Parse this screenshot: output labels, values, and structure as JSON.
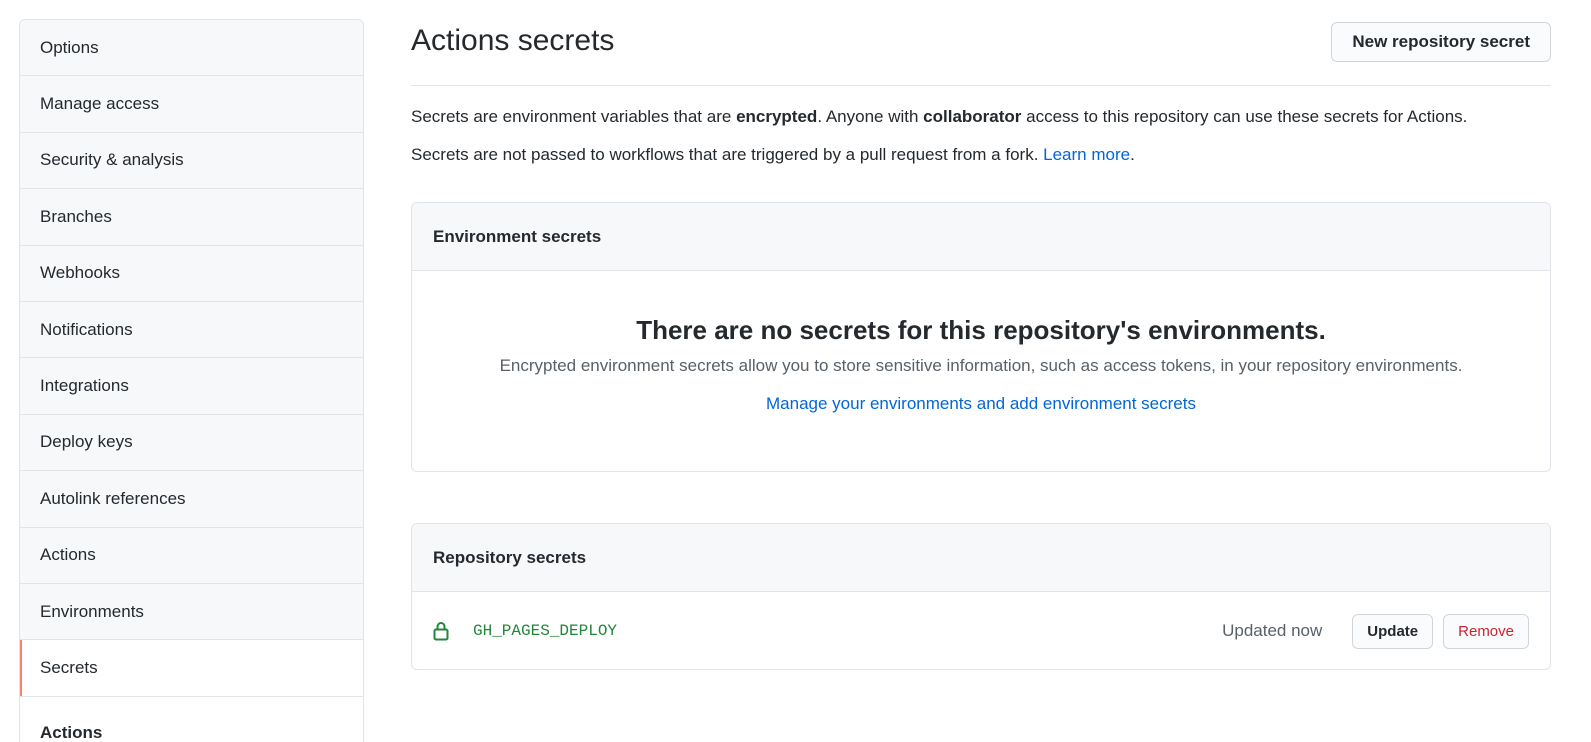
{
  "sidebar": {
    "items": [
      {
        "label": "Options"
      },
      {
        "label": "Manage access"
      },
      {
        "label": "Security & analysis"
      },
      {
        "label": "Branches"
      },
      {
        "label": "Webhooks"
      },
      {
        "label": "Notifications"
      },
      {
        "label": "Integrations"
      },
      {
        "label": "Deploy keys"
      },
      {
        "label": "Autolink references"
      },
      {
        "label": "Actions"
      },
      {
        "label": "Environments"
      },
      {
        "label": "Secrets"
      },
      {
        "label": "Actions"
      }
    ],
    "active": "Secrets",
    "active_color": "#f9826c"
  },
  "header": {
    "title": "Actions secrets",
    "new_button": "New repository secret"
  },
  "description": {
    "line1_a": "Secrets are environment variables that are ",
    "line1_b": "encrypted",
    "line1_c": ". Anyone with ",
    "line1_d": "collaborator",
    "line1_e": " access to this repository can use these secrets for Actions.",
    "line2_a": "Secrets are not passed to workflows that are triggered by a pull request from a fork. ",
    "line2_link": "Learn more",
    "line2_end": "."
  },
  "environment_secrets": {
    "heading": "Environment secrets",
    "empty_title": "There are no secrets for this repository's environments.",
    "empty_text": "Encrypted environment secrets allow you to store sensitive information, such as access tokens, in your repository environments.",
    "manage_link": "Manage your environments and add environment secrets"
  },
  "repository_secrets": {
    "heading": "Repository secrets",
    "rows": [
      {
        "icon": "lock-icon",
        "name": "GH_PAGES_DEPLOY",
        "updated": "Updated now",
        "update_label": "Update",
        "remove_label": "Remove"
      }
    ]
  },
  "colors": {
    "link": "#0366d6",
    "secret_name": "#22863a",
    "danger": "#cb2431"
  }
}
